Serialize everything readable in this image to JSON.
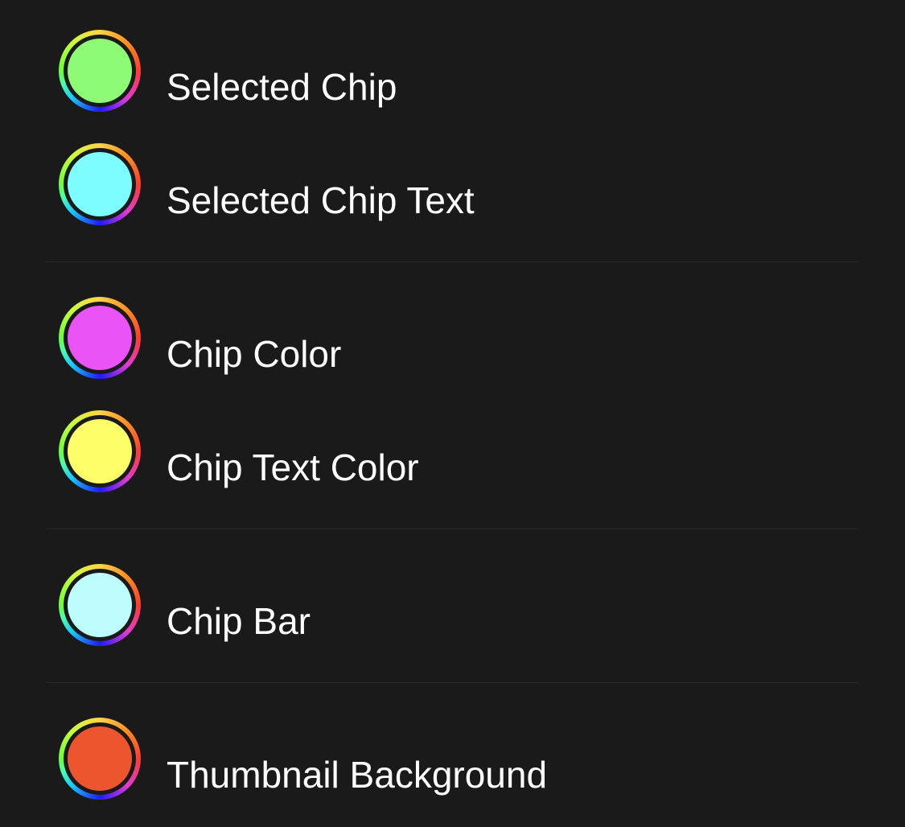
{
  "rows": [
    {
      "label": "Selected Chip",
      "color": "#8efb77"
    },
    {
      "label": "Selected Chip Text",
      "color": "#7dfdfe"
    },
    {
      "label": "Chip Color",
      "color": "#ea53f6"
    },
    {
      "label": "Chip Text Color",
      "color": "#fefe68"
    },
    {
      "label": "Chip Bar",
      "color": "#bdfdfe"
    },
    {
      "label": "Thumbnail Background",
      "color": "#ec552d"
    }
  ]
}
